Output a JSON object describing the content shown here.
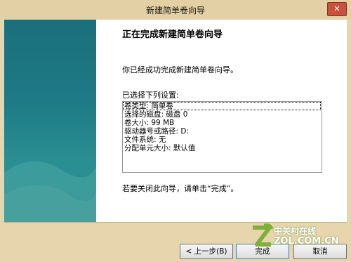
{
  "window": {
    "title": "新建简单卷向导",
    "close_glyph": "✕"
  },
  "wizard": {
    "heading": "正在完成新建简单卷向导",
    "success_text": "你已经成功完成新建简单卷向导。",
    "settings_label": "已选择下列设置:",
    "settings": [
      "卷类型: 简单卷",
      "选择的磁盘: 磁盘 0",
      "卷大小: 99 MB",
      "驱动器号或路径: D:",
      "文件系统: 无",
      "分配单元大小: 默认值"
    ],
    "close_hint": "若要关闭此向导，请单击“完成”。"
  },
  "buttons": {
    "back": "< 上一步(B)",
    "finish": "完成",
    "cancel": "取消"
  },
  "watermark": {
    "brand": "中关村在线",
    "site": "ZOL.COM.CN"
  },
  "colors": {
    "titlebar": "#e3d0a4",
    "side_panel": "#1d7a86",
    "close_button": "#c7523d"
  }
}
